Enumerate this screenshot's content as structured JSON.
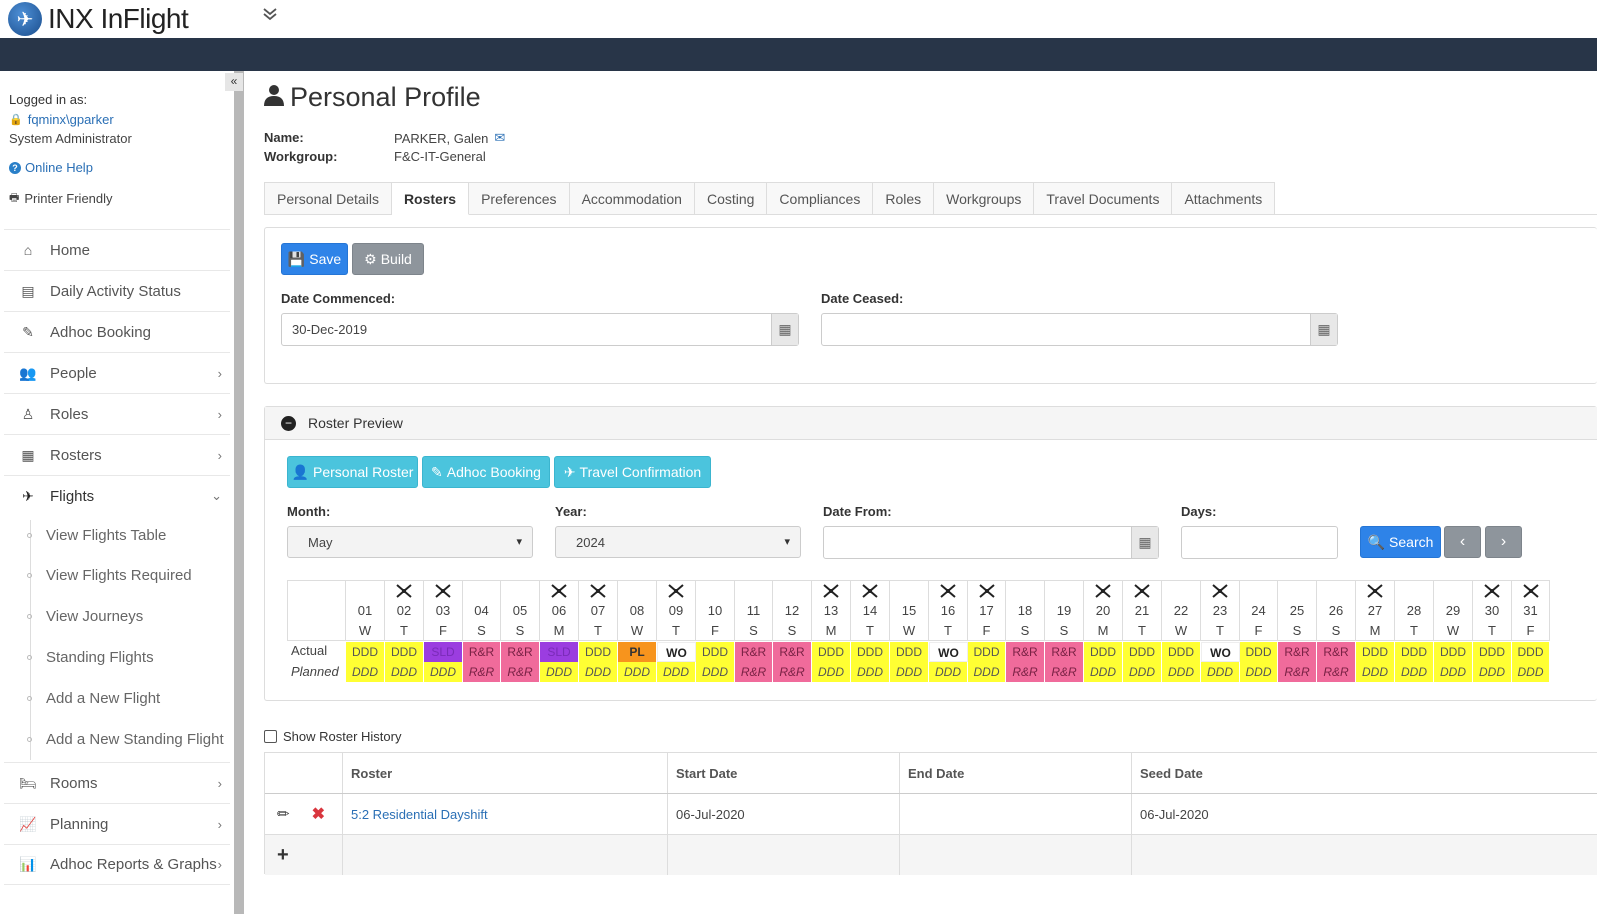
{
  "app": {
    "title": "INX InFlight"
  },
  "user": {
    "logged_in_label": "Logged in as:",
    "username": "fqminx\\gparker",
    "role": "System Administrator",
    "online_help": "Online Help",
    "printer_friendly": "Printer Friendly"
  },
  "sidebar": {
    "items": [
      {
        "label": "Home",
        "icon": "home-icon"
      },
      {
        "label": "Daily Activity Status",
        "icon": "list-icon"
      },
      {
        "label": "Adhoc Booking",
        "icon": "edit-icon"
      },
      {
        "label": "People",
        "icon": "users-icon"
      },
      {
        "label": "Roles",
        "icon": "user-icon"
      },
      {
        "label": "Rosters",
        "icon": "calendar-icon"
      },
      {
        "label": "Flights",
        "icon": "plane-icon"
      }
    ],
    "flights_sub": [
      "View Flights Table",
      "View Flights Required",
      "View Journeys",
      "Standing Flights",
      "Add a New Flight",
      "Add a New Standing Flight"
    ],
    "items_after": [
      {
        "label": "Rooms",
        "icon": "bed-icon"
      },
      {
        "label": "Planning",
        "icon": "line-chart-icon"
      },
      {
        "label": "Adhoc Reports & Graphs",
        "icon": "bar-chart-icon"
      }
    ]
  },
  "page": {
    "title": "Personal Profile",
    "name_label": "Name:",
    "name_value": "PARKER, Galen",
    "workgroup_label": "Workgroup:",
    "workgroup_value": "F&C-IT-General"
  },
  "tabs": [
    "Personal Details",
    "Rosters",
    "Preferences",
    "Accommodation",
    "Costing",
    "Compliances",
    "Roles",
    "Workgroups",
    "Travel Documents",
    "Attachments"
  ],
  "active_tab": "Rosters",
  "roster_form": {
    "save_label": "Save",
    "build_label": "Build",
    "date_commenced_label": "Date Commenced:",
    "date_commenced_value": "30-Dec-2019",
    "date_ceased_label": "Date Ceased:",
    "date_ceased_value": ""
  },
  "preview": {
    "header": "Roster Preview",
    "personal_roster": "Personal Roster",
    "adhoc_booking": "Adhoc Booking",
    "travel_confirmation": "Travel Confirmation",
    "month_label": "Month:",
    "month_value": "May",
    "year_label": "Year:",
    "year_value": "2024",
    "date_from_label": "Date From:",
    "date_from_value": "",
    "days_label": "Days:",
    "days_value": "",
    "search_label": "Search",
    "actual_label": "Actual",
    "planned_label": "Planned",
    "days": [
      {
        "d": "01",
        "w": "W",
        "plane": false,
        "a": "DDD",
        "p": "DDD"
      },
      {
        "d": "02",
        "w": "T",
        "plane": true,
        "a": "DDD",
        "p": "DDD"
      },
      {
        "d": "03",
        "w": "F",
        "plane": true,
        "a": "SLD",
        "p": "DDD"
      },
      {
        "d": "04",
        "w": "S",
        "plane": false,
        "a": "R&R",
        "p": "R&R"
      },
      {
        "d": "05",
        "w": "S",
        "plane": false,
        "a": "R&R",
        "p": "R&R"
      },
      {
        "d": "06",
        "w": "M",
        "plane": true,
        "a": "SLD",
        "p": "DDD"
      },
      {
        "d": "07",
        "w": "T",
        "plane": true,
        "a": "DDD",
        "p": "DDD"
      },
      {
        "d": "08",
        "w": "W",
        "plane": false,
        "a": "PL",
        "p": "DDD"
      },
      {
        "d": "09",
        "w": "T",
        "plane": true,
        "a": "WO",
        "p": "DDD"
      },
      {
        "d": "10",
        "w": "F",
        "plane": false,
        "a": "DDD",
        "p": "DDD"
      },
      {
        "d": "11",
        "w": "S",
        "plane": false,
        "a": "R&R",
        "p": "R&R"
      },
      {
        "d": "12",
        "w": "S",
        "plane": false,
        "a": "R&R",
        "p": "R&R"
      },
      {
        "d": "13",
        "w": "M",
        "plane": true,
        "a": "DDD",
        "p": "DDD"
      },
      {
        "d": "14",
        "w": "T",
        "plane": true,
        "a": "DDD",
        "p": "DDD"
      },
      {
        "d": "15",
        "w": "W",
        "plane": false,
        "a": "DDD",
        "p": "DDD"
      },
      {
        "d": "16",
        "w": "T",
        "plane": true,
        "a": "WO",
        "p": "DDD"
      },
      {
        "d": "17",
        "w": "F",
        "plane": true,
        "a": "DDD",
        "p": "DDD"
      },
      {
        "d": "18",
        "w": "S",
        "plane": false,
        "a": "R&R",
        "p": "R&R"
      },
      {
        "d": "19",
        "w": "S",
        "plane": false,
        "a": "R&R",
        "p": "R&R"
      },
      {
        "d": "20",
        "w": "M",
        "plane": true,
        "a": "DDD",
        "p": "DDD"
      },
      {
        "d": "21",
        "w": "T",
        "plane": true,
        "a": "DDD",
        "p": "DDD"
      },
      {
        "d": "22",
        "w": "W",
        "plane": false,
        "a": "DDD",
        "p": "DDD"
      },
      {
        "d": "23",
        "w": "T",
        "plane": true,
        "a": "WO",
        "p": "DDD"
      },
      {
        "d": "24",
        "w": "F",
        "plane": false,
        "a": "DDD",
        "p": "DDD"
      },
      {
        "d": "25",
        "w": "S",
        "plane": false,
        "a": "R&R",
        "p": "R&R"
      },
      {
        "d": "26",
        "w": "S",
        "plane": false,
        "a": "R&R",
        "p": "R&R"
      },
      {
        "d": "27",
        "w": "M",
        "plane": true,
        "a": "DDD",
        "p": "DDD"
      },
      {
        "d": "28",
        "w": "T",
        "plane": false,
        "a": "DDD",
        "p": "DDD"
      },
      {
        "d": "29",
        "w": "W",
        "plane": false,
        "a": "DDD",
        "p": "DDD"
      },
      {
        "d": "30",
        "w": "T",
        "plane": true,
        "a": "DDD",
        "p": "DDD"
      },
      {
        "d": "31",
        "w": "F",
        "plane": true,
        "a": "DDD",
        "p": "DDD"
      }
    ]
  },
  "code_colors": {
    "DDD": "#ffff33",
    "R&R": "#f06b9b",
    "SLD": "#9b3de0",
    "PL": "#f7941d",
    "WO": "#ffffff"
  },
  "history": {
    "show_label": "Show Roster History",
    "columns": [
      "Roster",
      "Start Date",
      "End Date",
      "Seed Date"
    ],
    "rows": [
      {
        "roster": "5:2 Residential Dayshift",
        "start": "06-Jul-2020",
        "end": "",
        "seed": "06-Jul-2020"
      }
    ]
  }
}
